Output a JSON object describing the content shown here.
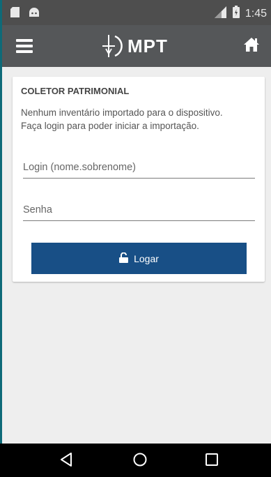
{
  "status_bar": {
    "time": "1:45",
    "icons": [
      "sd-card-icon",
      "android-icon",
      "signal-icon",
      "battery-icon"
    ]
  },
  "app_bar": {
    "logo_text": "MPT",
    "menu_icon": "hamburger-menu-icon",
    "home_icon": "home-icon"
  },
  "card": {
    "title": "COLETOR PATRIMONIAL",
    "message_line1": "Nenhum inventário importado para o dispositivo.",
    "message_line2": "Faça login para poder iniciar a importação.",
    "login_placeholder": "Login (nome.sobrenome)",
    "password_placeholder": "Senha",
    "login_button_label": "Logar",
    "login_button_icon": "unlock-icon"
  },
  "nav_bar": {
    "icons": [
      "back-icon",
      "home-circle-icon",
      "recents-icon"
    ]
  },
  "colors": {
    "status_bar": "#4e4e4e",
    "app_bar": "#555759",
    "background": "#eeeeee",
    "button": "#184f86",
    "nav_bar": "#000000",
    "frame_accent": "#0e6a78"
  }
}
